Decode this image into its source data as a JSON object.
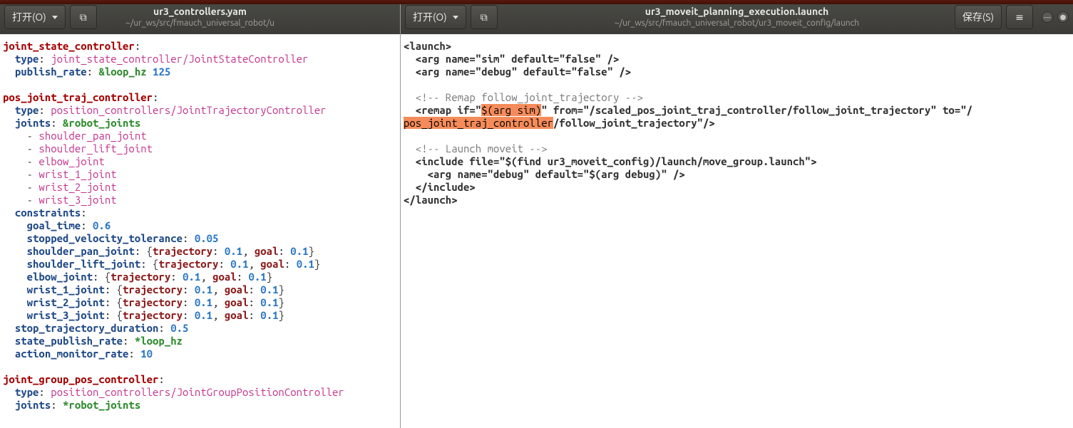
{
  "colors": {
    "highlight": "#f58b5a",
    "yaml_top": "#a40000",
    "yaml_sub": "#204a87",
    "yaml_str": "#c4328b",
    "yaml_num": "#2a76c6",
    "yaml_anchor": "#2f8b2f"
  },
  "left_window": {
    "open_button": "打开(O)",
    "title": "ur3_controllers.yam",
    "subtitle": "~/ur_ws/src/fmauch_universal_robot/u",
    "yaml": {
      "section1": {
        "name": "joint_state_controller",
        "type_key": "type",
        "type_val": "joint_state_controller/JointStateController",
        "publish_rate_key": "publish_rate",
        "publish_rate_anchor": "&loop_hz",
        "publish_rate_val": "125"
      },
      "section2": {
        "name": "pos_joint_traj_controller",
        "type_key": "type",
        "type_val": "position_controllers/JointTrajectoryController",
        "joints_key": "joints",
        "joints_anchor": "&robot_joints",
        "joints_list": [
          "shoulder_pan_joint",
          "shoulder_lift_joint",
          "elbow_joint",
          "wrist_1_joint",
          "wrist_2_joint",
          "wrist_3_joint"
        ],
        "constraints_key": "constraints",
        "constraints": {
          "goal_time_key": "goal_time",
          "goal_time_val": "0.6",
          "stopped_vel_key": "stopped_velocity_tolerance",
          "stopped_vel_val": "0.05",
          "items": [
            {
              "key": "shoulder_pan_joint",
              "traj": "0.1",
              "goal": "0.1"
            },
            {
              "key": "shoulder_lift_joint",
              "traj": "0.1",
              "goal": "0.1"
            },
            {
              "key": "elbow_joint",
              "traj": "0.1",
              "goal": "0.1"
            },
            {
              "key": "wrist_1_joint",
              "traj": "0.1",
              "goal": "0.1"
            },
            {
              "key": "wrist_2_joint",
              "traj": "0.1",
              "goal": "0.1"
            },
            {
              "key": "wrist_3_joint",
              "traj": "0.1",
              "goal": "0.1"
            }
          ],
          "traj_key": "trajectory",
          "goal_key": "goal"
        },
        "stop_traj_key": "stop_trajectory_duration",
        "stop_traj_val": "0.5",
        "state_pub_key": "state_publish_rate",
        "state_pub_val": "*loop_hz",
        "action_mon_key": "action_monitor_rate",
        "action_mon_val": "10"
      },
      "section3": {
        "name": "joint_group_pos_controller",
        "type_key": "type",
        "type_val": "position_controllers/JointGroupPositionController",
        "joints_key": "joints",
        "joints_val": "*robot_joints"
      }
    }
  },
  "right_window": {
    "open_button": "打开(O)",
    "save_button": "保存(S)",
    "title": "ur3_moveit_planning_execution.launch",
    "subtitle": "~/ur_ws/src/fmauch_universal_robot/ur3_moveit_config/launch",
    "xml": {
      "l1": "<launch>",
      "l2": "  <arg name=\"sim\" default=\"false\" />",
      "l3": "  <arg name=\"debug\" default=\"false\" />",
      "l4": "",
      "l5": "  <!-- Remap follow_joint_trajectory -->",
      "l6a": "  <remap if=\"",
      "l6b": "$(arg sim)",
      "l6c": "\" from=\"/scaled_pos_joint_traj_controller/follow_joint_trajectory\" to=\"/",
      "l7a": "pos_joint_traj_controller",
      "l7b": "/follow_joint_trajectory\"/>",
      "l8": "",
      "l9": "  <!-- Launch moveit -->",
      "l10": "  <include file=\"$(find ur3_moveit_config)/launch/move_group.launch\">",
      "l11": "    <arg name=\"debug\" default=\"$(arg debug)\" />",
      "l12": "  </include>",
      "l13": "</launch>"
    }
  }
}
